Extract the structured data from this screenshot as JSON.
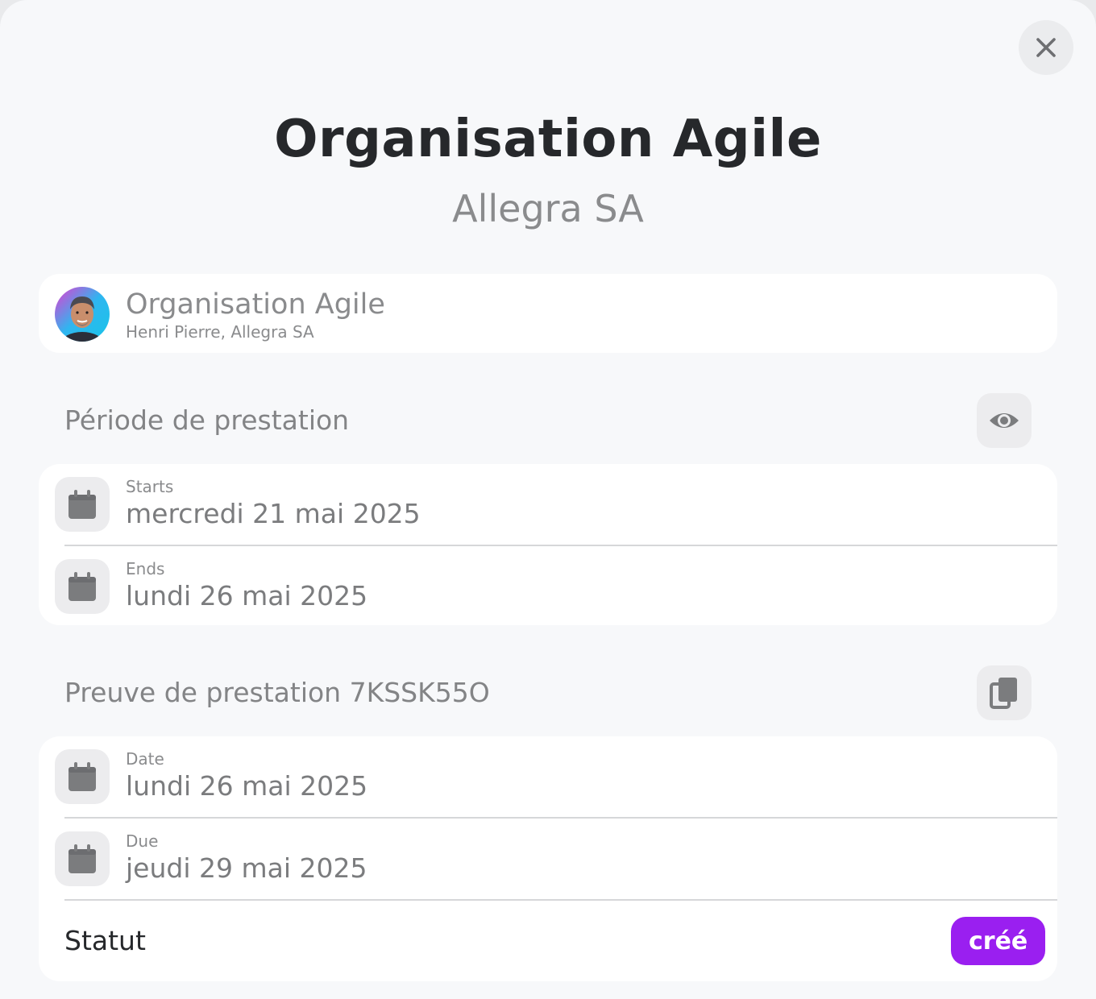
{
  "header": {
    "title": "Organisation Agile",
    "subtitle": "Allegra SA"
  },
  "client": {
    "name": "Organisation Agile",
    "contact": "Henri Pierre, Allegra SA"
  },
  "periode": {
    "title": "Période de prestation",
    "rows": [
      {
        "label": "Starts",
        "value": "mercredi 21 mai 2025"
      },
      {
        "label": "Ends",
        "value": "lundi 26 mai 2025"
      }
    ]
  },
  "preuve": {
    "title": "Preuve de prestation 7KSSK55O",
    "rows": [
      {
        "label": "Date",
        "value": "lundi 26 mai 2025"
      },
      {
        "label": "Due",
        "value": "jeudi 29 mai 2025"
      }
    ],
    "status_label": "Statut",
    "status_value": "créé"
  },
  "icons": {
    "close": "close-icon",
    "view": "eye-icon",
    "copy": "copy-icon",
    "calendar": "calendar-icon"
  },
  "colors": {
    "accent": "#9a1ff0",
    "background": "#f7f8fa",
    "card": "#ffffff"
  }
}
